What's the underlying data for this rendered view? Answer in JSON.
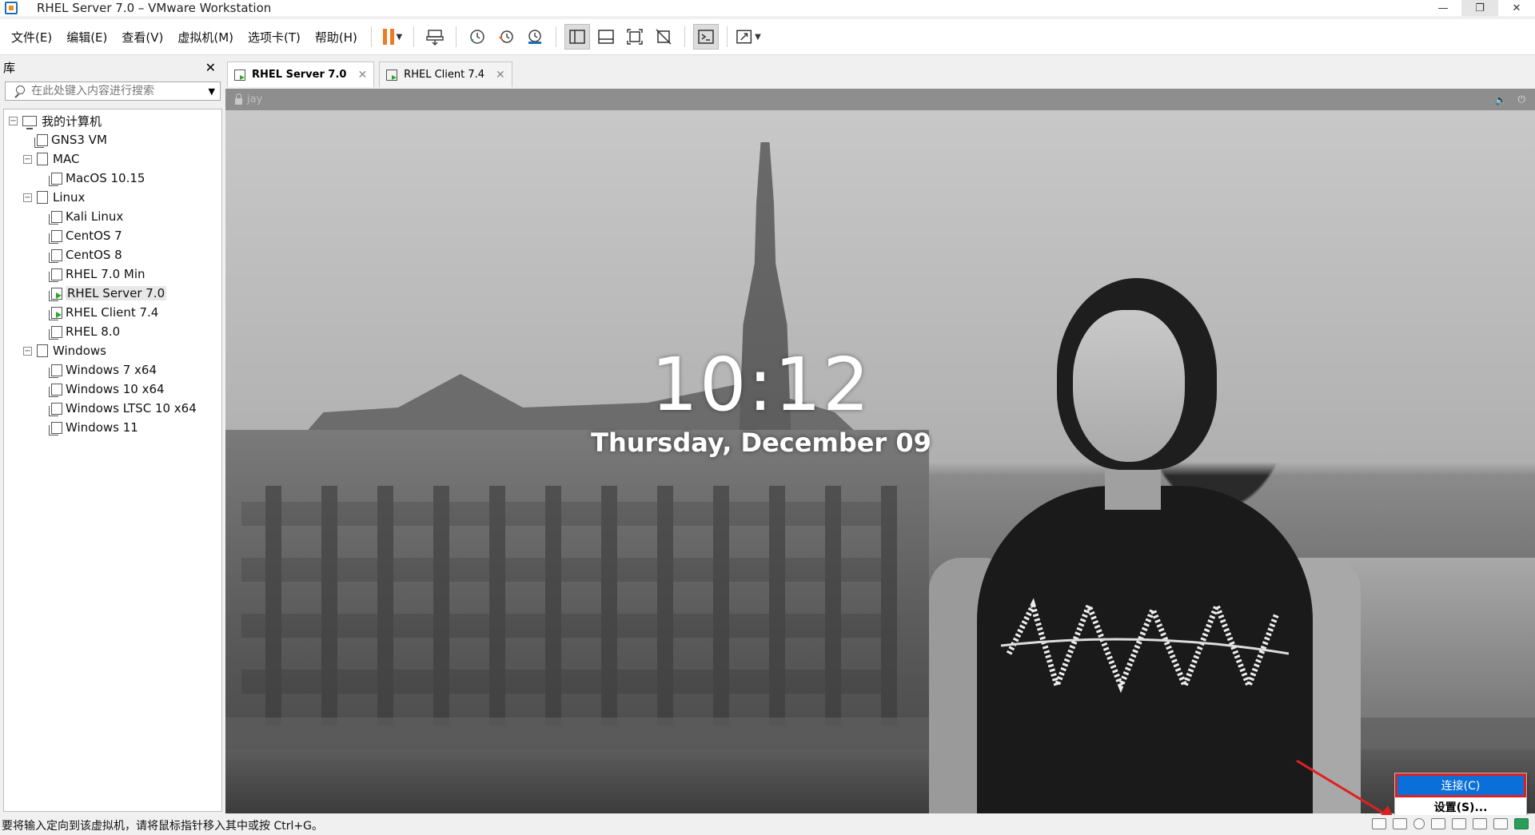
{
  "window": {
    "title": "RHEL Server 7.0 – VMware Workstation",
    "controls": [
      "—",
      "❐",
      "✕"
    ]
  },
  "menu": [
    "文件(E)",
    "编辑(E)",
    "查看(V)",
    "虚拟机(M)",
    "选项卡(T)",
    "帮助(H)"
  ],
  "library": {
    "title": "库",
    "close": "✕",
    "search_placeholder": "在此处键入内容进行搜索",
    "tree": [
      {
        "label": "我的计算机",
        "type": "pc",
        "level": 0,
        "expander": "⊟"
      },
      {
        "label": "GNS3 VM",
        "type": "vm",
        "level": 1
      },
      {
        "label": "MAC",
        "type": "folder",
        "level": 1,
        "expander": "⊟"
      },
      {
        "label": "MacOS 10.15",
        "type": "vm",
        "level": 2
      },
      {
        "label": "Linux",
        "type": "folder",
        "level": 1,
        "expander": "⊟"
      },
      {
        "label": "Kali Linux",
        "type": "vm",
        "level": 2
      },
      {
        "label": "CentOS 7",
        "type": "vm",
        "level": 2
      },
      {
        "label": "CentOS 8",
        "type": "vm",
        "level": 2
      },
      {
        "label": "RHEL 7.0 Min",
        "type": "vm",
        "level": 2
      },
      {
        "label": "RHEL Server 7.0",
        "type": "vm-running",
        "level": 2,
        "selected": true
      },
      {
        "label": "RHEL Client  7.4",
        "type": "vm-running",
        "level": 2
      },
      {
        "label": "RHEL 8.0",
        "type": "vm",
        "level": 2
      },
      {
        "label": "Windows",
        "type": "folder",
        "level": 1,
        "expander": "⊟"
      },
      {
        "label": "Windows 7 x64",
        "type": "vm",
        "level": 2
      },
      {
        "label": "Windows 10 x64",
        "type": "vm",
        "level": 2
      },
      {
        "label": "Windows LTSC 10 x64",
        "type": "vm",
        "level": 2
      },
      {
        "label": "Windows 11",
        "type": "vm",
        "level": 2
      }
    ]
  },
  "tabs": [
    {
      "label": "RHEL Server 7.0",
      "active": true,
      "close": "✕"
    },
    {
      "label": "RHEL Client  7.4",
      "active": false,
      "close": "✕"
    }
  ],
  "vm": {
    "user": "jay",
    "time": "10:12",
    "date": "Thursday, December 09"
  },
  "status": {
    "message": "要将输入定向到该虚拟机，请将鼠标指针移入其中或按 Ctrl+G。"
  },
  "popup": {
    "connect": "连接(C)",
    "settings": "设置(S)..."
  },
  "colors": {
    "accent": "#0a6fd8",
    "highlight_border": "#e02020",
    "pause": "#f07a22"
  }
}
